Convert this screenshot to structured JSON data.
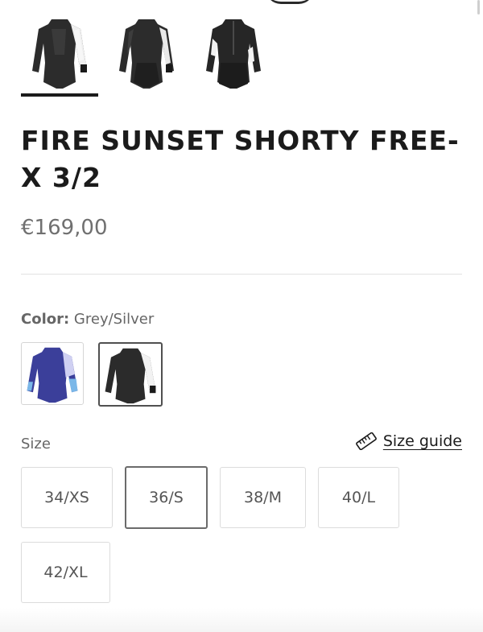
{
  "product": {
    "title": "FIRE SUNSET SHORTY FREE-X 3/2",
    "price": "€169,00"
  },
  "gallery": {
    "thumbnails": [
      {
        "name": "front-view",
        "selected": true
      },
      {
        "name": "front-alt-view",
        "selected": false
      },
      {
        "name": "back-view",
        "selected": false
      }
    ]
  },
  "color": {
    "label": "Color:",
    "selected": "Grey/Silver",
    "swatches": [
      {
        "name": "blue-purple",
        "primary": "#3b3f9a",
        "accent": "#7ab7e8"
      },
      {
        "name": "grey-silver",
        "primary": "#2b2b2b",
        "accent": "#f2f2f2"
      }
    ]
  },
  "size": {
    "label": "Size",
    "guide_label": "Size guide",
    "options": [
      "34/XS",
      "36/S",
      "38/M",
      "40/L",
      "42/XL"
    ],
    "selected": "36/S"
  },
  "colors": {
    "text": "#1b1b1b",
    "muted": "#707070",
    "border": "#dcdcdc",
    "selected_border": "#6b6b6b"
  }
}
